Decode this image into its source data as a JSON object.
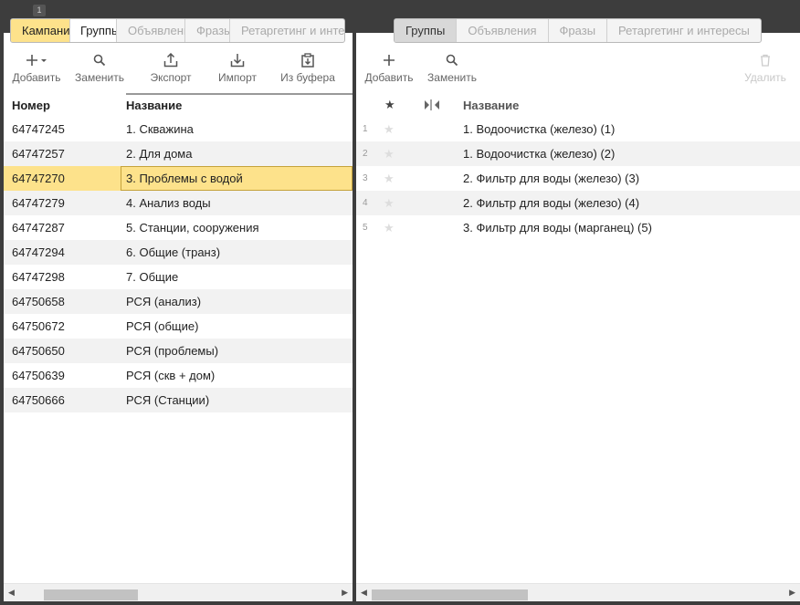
{
  "badge": "1",
  "left": {
    "tabs": [
      "Кампании",
      "Группы",
      "Объявления",
      "Фразы",
      "Ретаргетинг и интересы"
    ],
    "toolbar": {
      "add": "Добавить",
      "replace": "Заменить",
      "export": "Экспорт",
      "import": "Импорт",
      "from_buffer": "Из буфера"
    },
    "columns": {
      "number": "Номер",
      "name": "Название"
    },
    "rows": [
      {
        "number": "64747245",
        "name": "1. Скважина"
      },
      {
        "number": "64747257",
        "name": "2. Для дома"
      },
      {
        "number": "64747270",
        "name": "3. Проблемы с водой"
      },
      {
        "number": "64747279",
        "name": "4. Анализ воды"
      },
      {
        "number": "64747287",
        "name": "5. Станции, сооружения"
      },
      {
        "number": "64747294",
        "name": "6. Общие (транз)"
      },
      {
        "number": "64747298",
        "name": "7. Общие"
      },
      {
        "number": "64750658",
        "name": "РСЯ (анализ)"
      },
      {
        "number": "64750672",
        "name": "РСЯ (общие)"
      },
      {
        "number": "64750650",
        "name": "РСЯ (проблемы)"
      },
      {
        "number": "64750639",
        "name": "РСЯ (скв + дом)"
      },
      {
        "number": "64750666",
        "name": "РСЯ (Станции)"
      }
    ]
  },
  "right": {
    "tabs": [
      "Группы",
      "Объявления",
      "Фразы",
      "Ретаргетинг и интересы"
    ],
    "toolbar": {
      "add": "Добавить",
      "replace": "Заменить",
      "delete": "Удалить"
    },
    "columns": {
      "name": "Название"
    },
    "rows": [
      {
        "index": "1",
        "name": "1. Водоочистка (железо) (1)"
      },
      {
        "index": "2",
        "name": "1. Водоочистка (железо) (2)"
      },
      {
        "index": "3",
        "name": "2. Фильтр для воды (железо) (3)"
      },
      {
        "index": "4",
        "name": "2. Фильтр для воды (железо) (4)"
      },
      {
        "index": "5",
        "name": "3. Фильтр для воды (марганец) (5)"
      }
    ]
  },
  "colors": {
    "selected": "#fde28b",
    "alt_row": "#f2f2f2",
    "background": "#3d3d3d"
  }
}
